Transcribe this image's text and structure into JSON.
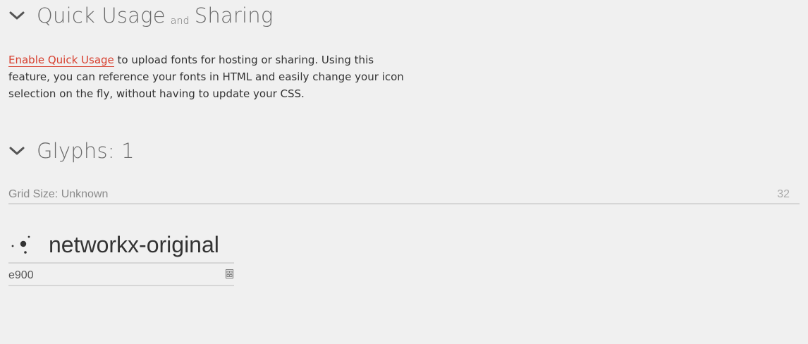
{
  "sections": {
    "quick_usage": {
      "title_part1": "Quick Usage",
      "title_join": "and",
      "title_part2": "Sharing",
      "link_text": "Enable Quick Usage",
      "description": " to upload fonts for hosting or sharing. Using this feature, you can reference your fonts in HTML and easily change your icon selection on the fly, without having to update your CSS."
    },
    "glyphs": {
      "title": "Glyphs: 1",
      "grid_label": "Grid Size: Unknown",
      "grid_size_value": "32"
    }
  },
  "glyph_items": [
    {
      "name": "networkx-original",
      "code": "e900"
    }
  ],
  "icons": {
    "section_toggle": "chevron-down-icon",
    "glyph_preview": "networkx-icon",
    "code_toggle": "hex-code-icon"
  },
  "colors": {
    "background": "#f0f0f0",
    "link": "#d7402f",
    "heading": "#6b6b6b",
    "divider": "#d6d6d6"
  }
}
